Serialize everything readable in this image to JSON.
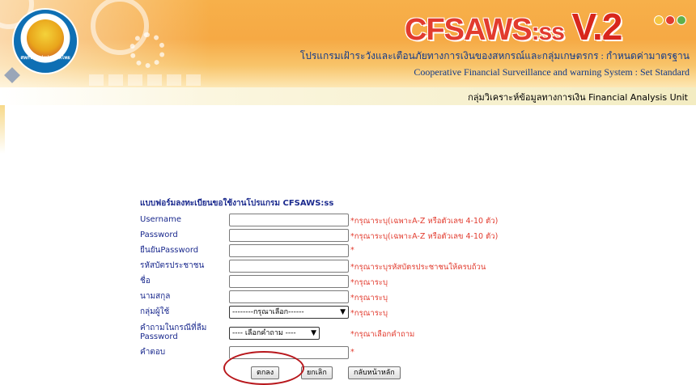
{
  "header": {
    "logo_text": "สหกรณ์แห่งประเทศไทย",
    "title_main": "CFSAWS",
    "title_suffix": ":ss",
    "title_version": "V.2",
    "subtitle_th": "โปรแกรมเฝ้าระวังและเตือนภัยทางการเงินของสหกรณ์และกลุ่มเกษตรกร : กำหนดค่ามาตรฐาน",
    "subtitle_en": "Cooperative Financial Surveillance and warning System : Set Standard",
    "unit_label": "กลุ่มวิเคราะห์ข้อมูลทางการเงิน   Financial Analysis Unit",
    "dot_colors": [
      "#f4c542",
      "#e23b2e",
      "#5fb04a"
    ]
  },
  "form": {
    "title": "แบบฟอร์มลงทะเบียนขอใช้งานโปรแกรม CFSAWS:ss",
    "fields": [
      {
        "label": "Username",
        "value": "",
        "hint": "*กรุณาระบุ(เฉพาะA-Z หรือตัวเลข 4-10 ตัว)"
      },
      {
        "label": "Password",
        "value": "",
        "hint": "*กรุณาระบุ(เฉพาะA-Z หรือตัวเลข 4-10 ตัว)"
      },
      {
        "label": "ยืนยันPassword",
        "value": "",
        "hint": "*"
      },
      {
        "label": "รหัสบัตรประชาชน",
        "value": "",
        "hint": "*กรุณาระบุรหัสบัตรประชาชนให้ครบถ้วน"
      },
      {
        "label": "ชื่อ",
        "value": "",
        "hint": "*กรุณาระบุ"
      },
      {
        "label": "นามสกุล",
        "value": "",
        "hint": "*กรุณาระบุ"
      },
      {
        "label": "กลุ่มผู้ใช้",
        "selected": "--------กรุณาเลือก------",
        "hint": "*กรุณาระบุ"
      },
      {
        "label_line1": "คำถามในกรณีที่ลืม",
        "label_line2": "Password",
        "selected": "---- เลือกคำถาม ----",
        "hint": "*กรุณาเลือกคำถาม"
      },
      {
        "label": "คำตอบ",
        "value": "",
        "hint": "*"
      }
    ],
    "buttons": {
      "ok": "ตกลง",
      "cancel": "ยกเลิก",
      "home": "กลับหน้าหลัก"
    }
  },
  "accent_colors": {
    "label": "#1b2a8e",
    "hint": "#e23b2e",
    "highlight": "#b8171c"
  }
}
